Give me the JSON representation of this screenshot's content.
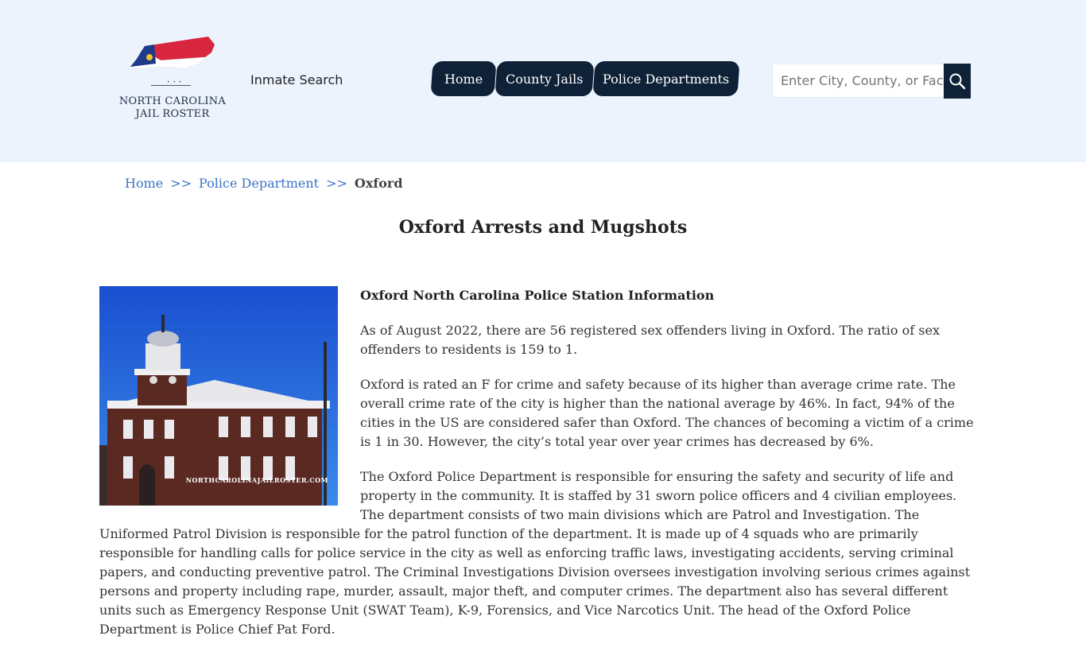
{
  "header": {
    "logo": {
      "line1": "NORTH CAROLINA",
      "line2": "JAIL ROSTER",
      "flag_colors": {
        "red": "#d7263d",
        "blue": "#1e3a8a",
        "white": "#ffffff",
        "gold": "#f2c12e"
      }
    },
    "inmate_search_label": "Inmate Search",
    "nav": [
      {
        "label": "Home"
      },
      {
        "label": "County Jails"
      },
      {
        "label": "Police Departments"
      }
    ],
    "search": {
      "placeholder": "Enter City, County, or Facility",
      "icon": "search-icon"
    }
  },
  "breadcrumb": {
    "items": [
      "Home",
      "Police Department",
      "Oxford"
    ],
    "separator": ">>"
  },
  "page_title": "Oxford Arrests and Mugshots",
  "article": {
    "image_watermark": "NORTHCAROLINAJAILROSTER.COM",
    "subheading": "Oxford North Carolina Police Station Information",
    "paragraphs": [
      "As of August 2022, there are 56 registered sex offenders living in Oxford. The ratio of sex offenders to residents is 159 to 1.",
      "Oxford is rated an F for crime and safety because of its higher than average crime rate. The overall crime rate of the city is higher than the national average by 46%. In fact, 94% of the cities in the US are considered safer than Oxford. The chances of becoming a victim of a crime is 1 in 30. However, the city’s total year over year crimes has decreased by 6%.",
      "The Oxford Police Department is responsible for ensuring the safety and security of life and property in the community. It is staffed by 31 sworn police officers and 4 civilian employees. The department consists of two main divisions which are Patrol and Investigation. The Uniformed Patrol Division is responsible for the patrol function of the department. It is made up of 4 squads who are primarily responsible for handling calls for police service in the city as well as enforcing traffic laws, investigating accidents, serving criminal papers, and conducting preventive patrol. The Criminal Investigations Division oversees investigation involving serious crimes against persons and property including rape, murder, assault, major theft, and computer crimes. The department also has several different units such as Emergency Response Unit (SWAT Team), K-9, Forensics, and Vice Narcotics Unit. The head of the Oxford Police Department is Police Chief Pat Ford."
    ]
  },
  "colors": {
    "header_bg": "#edf3fd",
    "nav_bg": "#0e2136",
    "link": "#3a74c8"
  }
}
